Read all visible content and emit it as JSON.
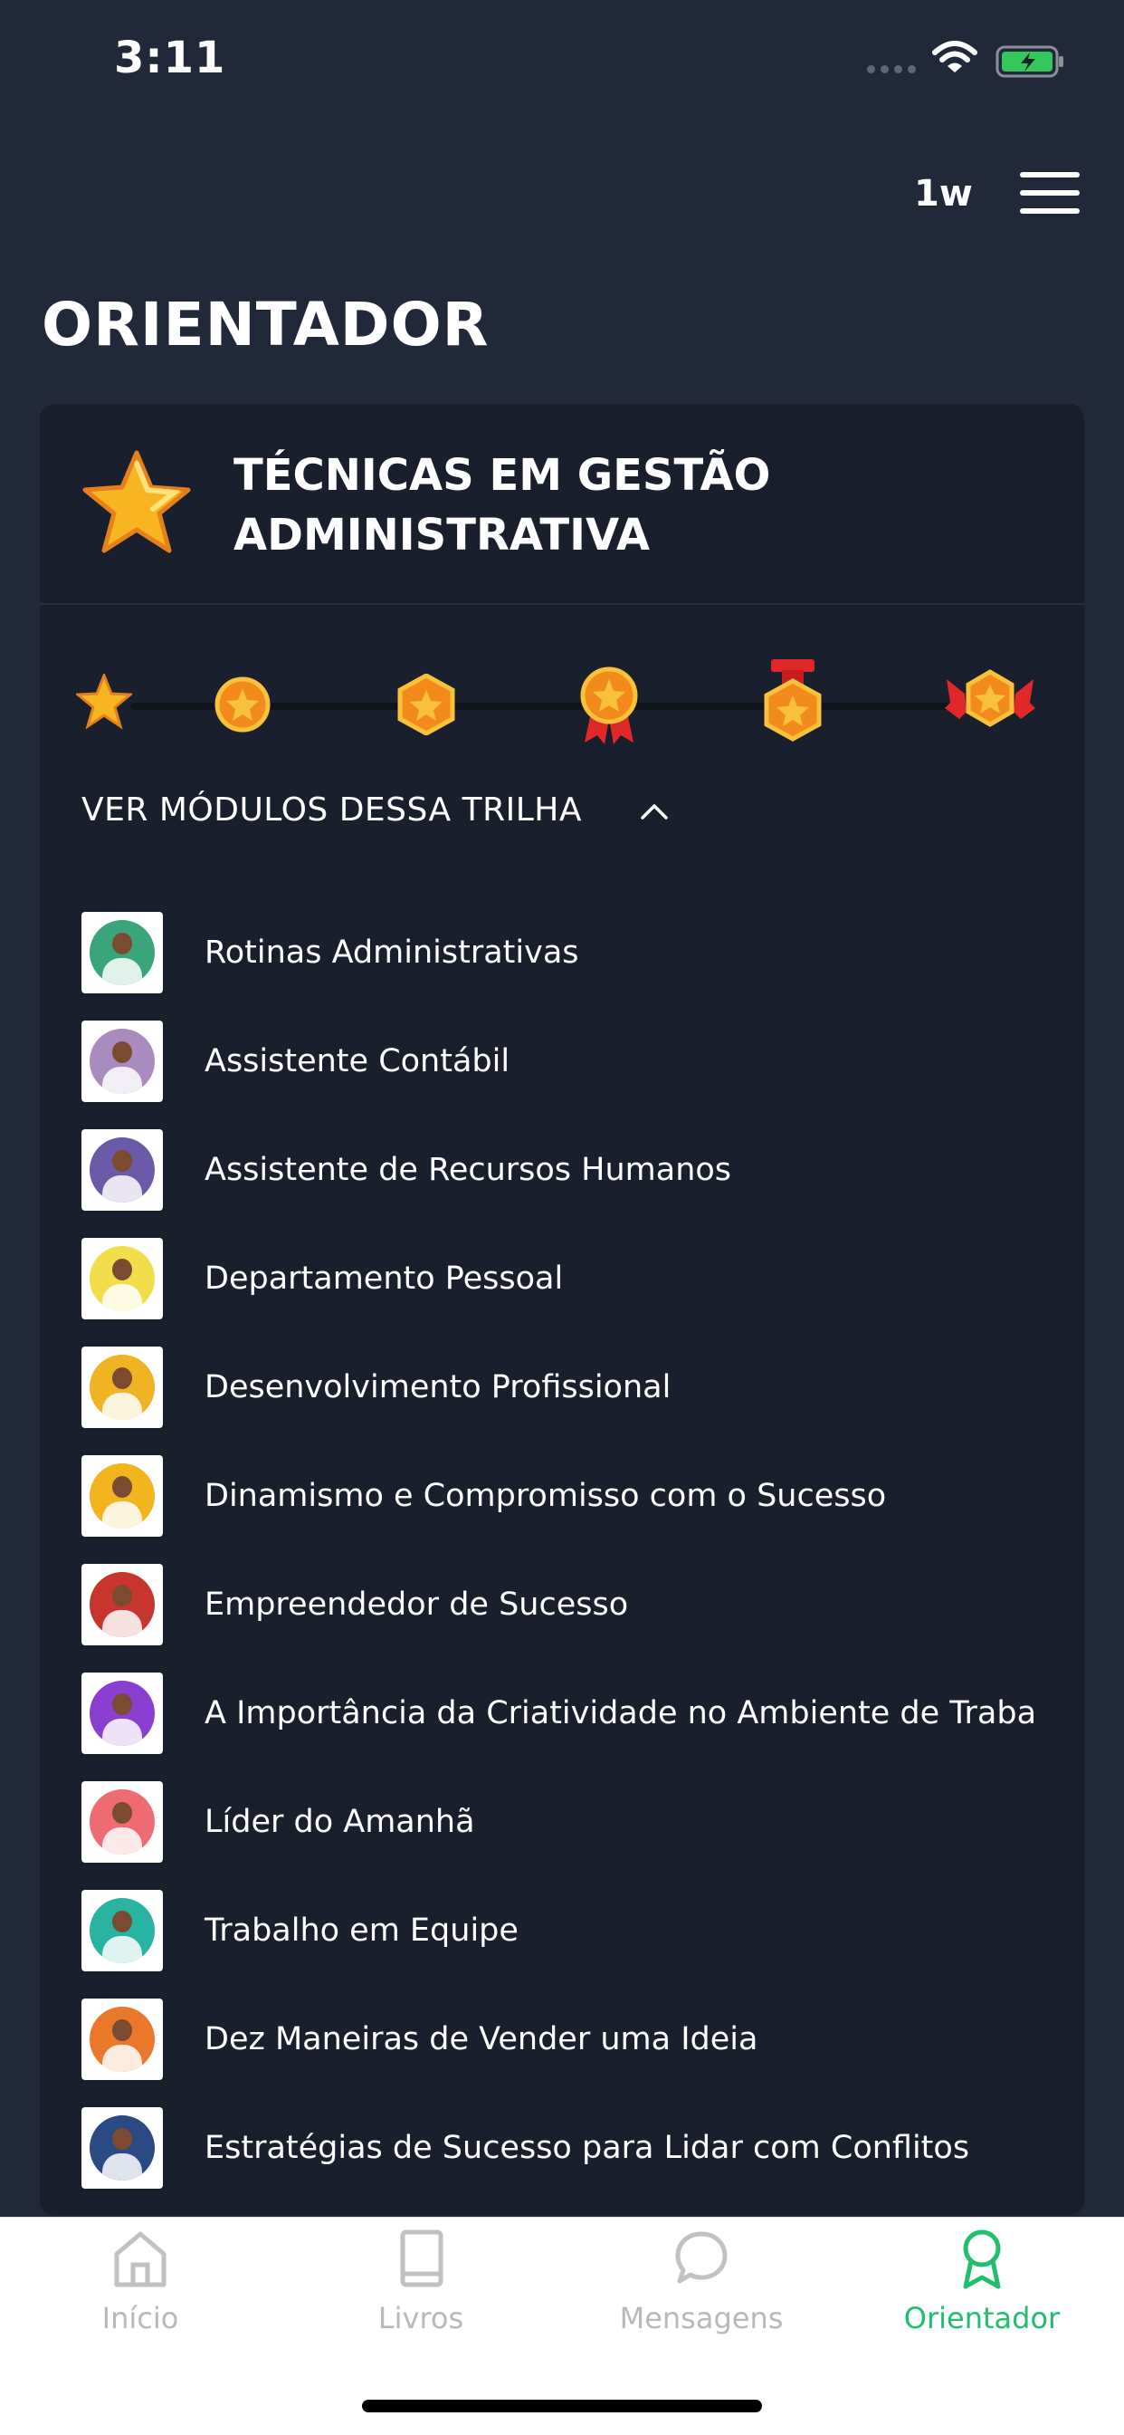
{
  "status_bar": {
    "time": "3:11"
  },
  "header": {
    "week_label": "1w",
    "title": "ORIENTADOR"
  },
  "track": {
    "title": "TÉCNICAS EM GESTÃO ADMINISTRATIVA",
    "toggle_label": "VER MÓDULOS DESSA TRILHA",
    "medals": [
      "star",
      "medal-bronze",
      "medal-hex",
      "medal-ribbon",
      "medal-banner",
      "medal-wings"
    ],
    "modules": [
      {
        "title": "Rotinas Administrativas",
        "color": "#3aa57a"
      },
      {
        "title": "Assistente Contábil",
        "color": "#a98bbd"
      },
      {
        "title": "Assistente de Recursos Humanos",
        "color": "#6b5aa8"
      },
      {
        "title": "Departamento Pessoal",
        "color": "#f1de4a"
      },
      {
        "title": "Desenvolvimento Profissional",
        "color": "#f0b323"
      },
      {
        "title": "Dinamismo e Compromisso com o Sucesso",
        "color": "#f2b51d"
      },
      {
        "title": "Empreendedor de Sucesso",
        "color": "#c6362f"
      },
      {
        "title": "A Importância da Criatividade no Ambiente de Traba",
        "color": "#8a3fd0"
      },
      {
        "title": "Líder do Amanhã",
        "color": "#ee6b74"
      },
      {
        "title": "Trabalho em Equipe",
        "color": "#28b4a0"
      },
      {
        "title": "Dez Maneiras de Vender uma Ideia",
        "color": "#e9782a"
      },
      {
        "title": "Estratégias de Sucesso para Lidar com Conflitos",
        "color": "#2b4a83"
      }
    ]
  },
  "tab_bar": {
    "tabs": [
      {
        "label": "Início",
        "icon": "home-icon"
      },
      {
        "label": "Livros",
        "icon": "book-icon"
      },
      {
        "label": "Mensagens",
        "icon": "chat-icon"
      },
      {
        "label": "Orientador",
        "icon": "ribbon-icon"
      }
    ],
    "active": 3
  },
  "colors": {
    "accent": "#1fbf6c",
    "background": "#20283a",
    "card": "#1a1f2d"
  }
}
